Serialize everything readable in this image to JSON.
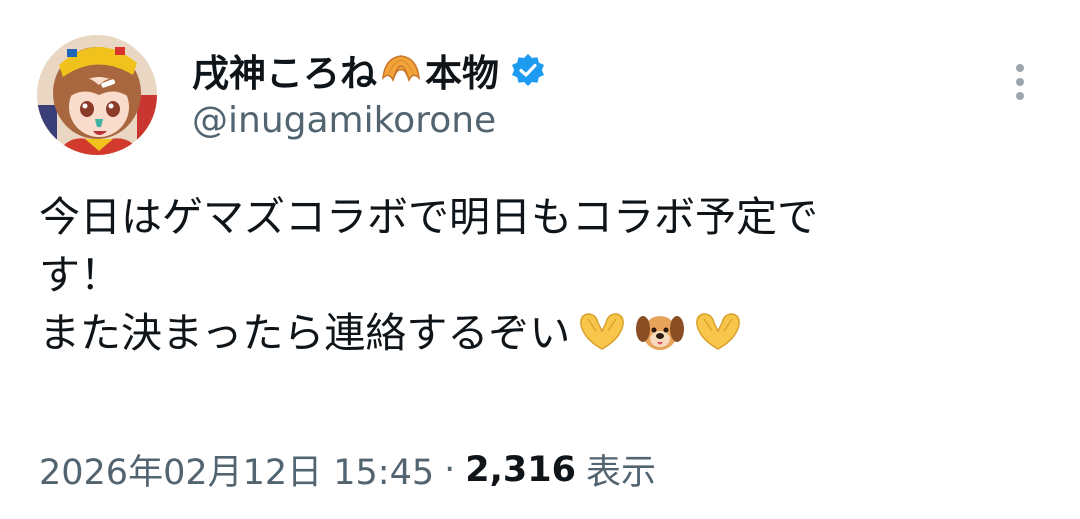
{
  "tweet": {
    "display_name_part1": "戌神ころね",
    "display_name_emoji": "croissant-icon",
    "display_name_part2": "本物",
    "verified_icon": "verified-badge-icon",
    "handle": "@inugamikorone",
    "body_line1": "今日はゲマズコラボで明日もコラボ予定で",
    "body_line2": "す！",
    "body_line3": "また決まったら連絡するぞい",
    "body_emojis": [
      "heart-hands-icon",
      "dog-face-icon",
      "heart-hands-icon"
    ],
    "timestamp": "2026年02月12日 15:45",
    "separator": "·",
    "views_count": "2,316",
    "views_label": "表示"
  },
  "colors": {
    "text": "#0f1419",
    "secondary": "#536471",
    "verified": "#1d9bf0",
    "more": "#9aa5ae"
  }
}
